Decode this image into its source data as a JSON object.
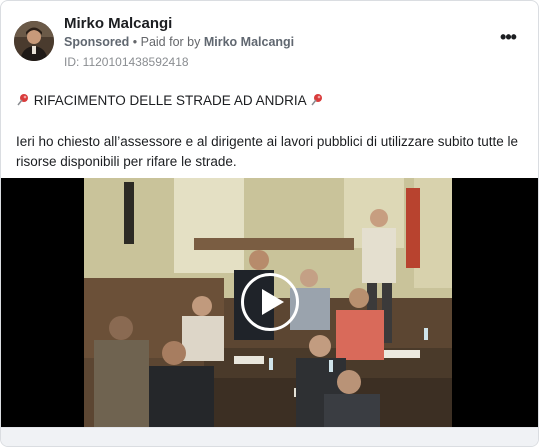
{
  "ad": {
    "advertiser_name": "Mirko Malcangi",
    "sponsored_label": "Sponsored",
    "paid_for_prefix": " • Paid for by ",
    "paid_for_name": "Mirko Malcangi",
    "id_line": "ID: 1120101438592418",
    "more_label": "•••"
  },
  "post": {
    "headline": "RIFACIMENTO DELLE STRADE AD ANDRIA",
    "body": "Ieri ho chiesto all’assessore e al dirigente ai lavori pubblici di utilizzare subito tutte le risorse disponibili per rifare le strade."
  },
  "icons": {
    "pin": "pushpin-icon",
    "play": "play-icon",
    "more": "more-options-icon"
  },
  "colors": {
    "pin_red": "#d93c3c",
    "text": "#1c1e21",
    "secondary": "#65676b"
  }
}
